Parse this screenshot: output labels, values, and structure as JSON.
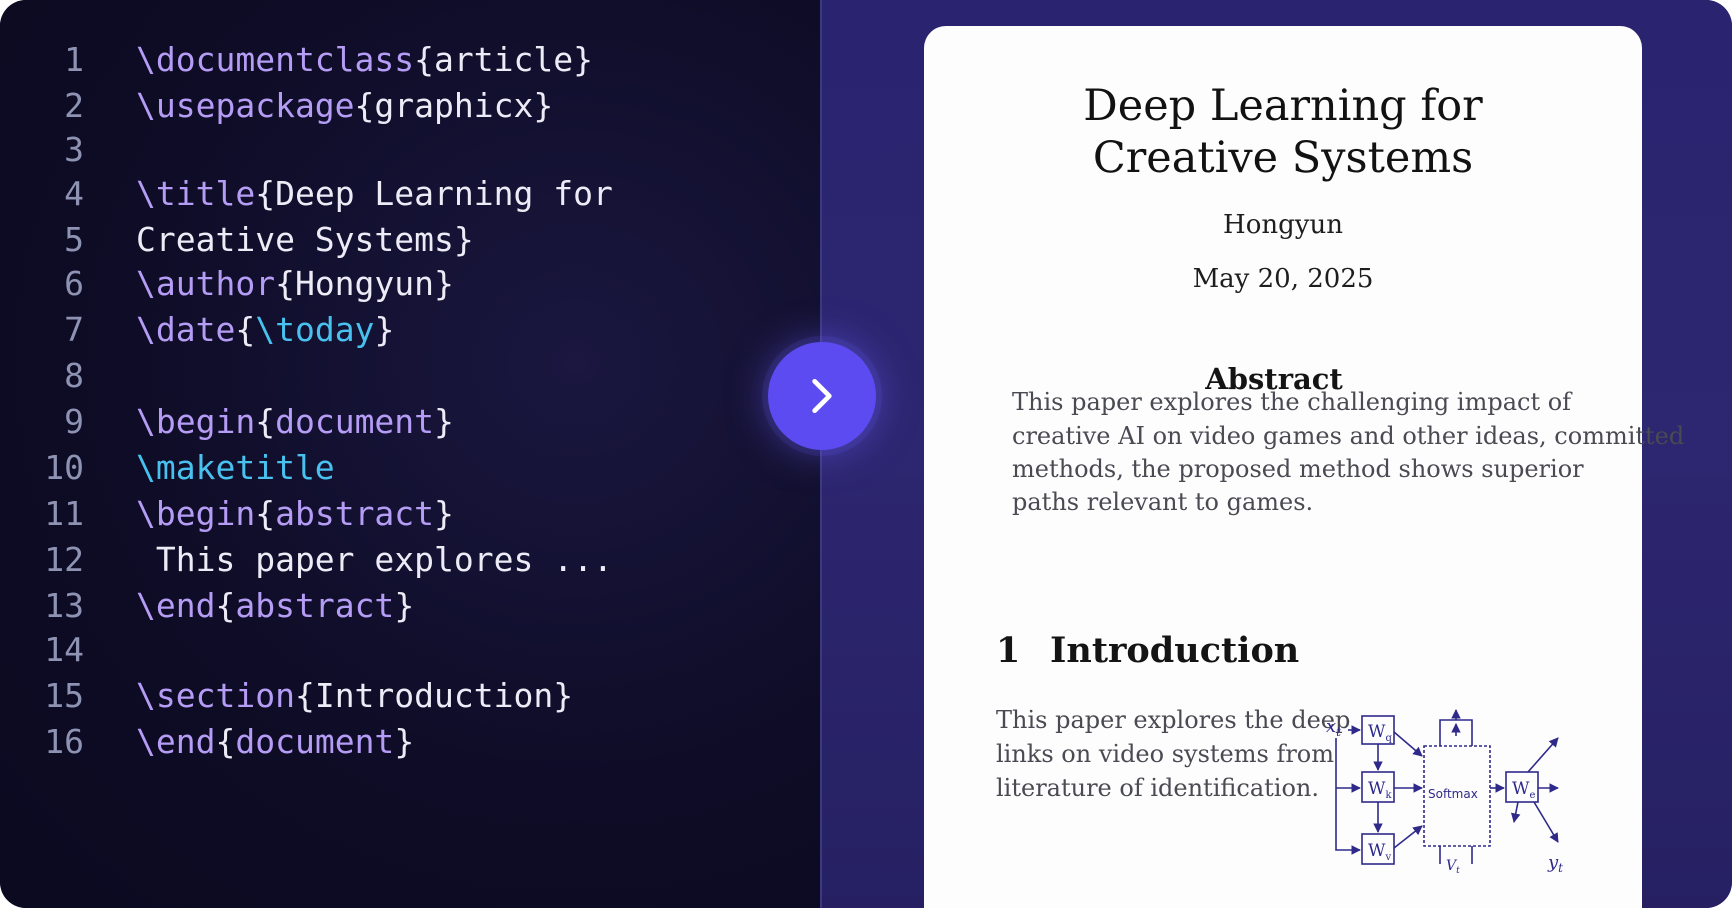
{
  "editor": {
    "lines": [
      {
        "n": "1",
        "parts": [
          [
            "kw",
            "\\documentclass"
          ],
          [
            "txt",
            "{article}"
          ]
        ]
      },
      {
        "n": "2",
        "parts": [
          [
            "kw",
            "\\usepackage"
          ],
          [
            "txt",
            "{graphicx}"
          ]
        ]
      },
      {
        "n": "3",
        "parts": []
      },
      {
        "n": "4",
        "parts": [
          [
            "kw",
            "\\title"
          ],
          [
            "txt",
            "{Deep Learning for"
          ]
        ]
      },
      {
        "n": "5",
        "parts": [
          [
            "txt",
            "Creative Systems}"
          ]
        ]
      },
      {
        "n": "6",
        "parts": [
          [
            "kw",
            "\\author"
          ],
          [
            "txt",
            "{Hongyun}"
          ]
        ]
      },
      {
        "n": "7",
        "parts": [
          [
            "kw",
            "\\date"
          ],
          [
            "txt",
            "{"
          ],
          [
            "cyan",
            "\\today"
          ],
          [
            "txt",
            "}"
          ]
        ]
      },
      {
        "n": "8",
        "parts": []
      },
      {
        "n": "9",
        "parts": [
          [
            "kw",
            "\\begin"
          ],
          [
            "txt",
            "{"
          ],
          [
            "arg",
            "document"
          ],
          [
            "txt",
            "}"
          ]
        ]
      },
      {
        "n": "10",
        "parts": [
          [
            "cyan",
            "\\maketitle"
          ]
        ]
      },
      {
        "n": "11",
        "parts": [
          [
            "kw",
            "\\begin"
          ],
          [
            "txt",
            "{"
          ],
          [
            "arg",
            "abstract"
          ],
          [
            "txt",
            "}"
          ]
        ]
      },
      {
        "n": "12",
        "parts": [
          [
            "txt",
            " This paper explores ..."
          ]
        ]
      },
      {
        "n": "13",
        "parts": [
          [
            "kw",
            "\\end"
          ],
          [
            "txt",
            "{"
          ],
          [
            "arg",
            "abstract"
          ],
          [
            "txt",
            "}"
          ]
        ]
      },
      {
        "n": "14",
        "parts": []
      },
      {
        "n": "15",
        "parts": [
          [
            "kw",
            "\\section"
          ],
          [
            "txt",
            "{Introduction}"
          ]
        ]
      },
      {
        "n": "16",
        "parts": [
          [
            "kw",
            "\\end"
          ],
          [
            "txt",
            "{"
          ],
          [
            "arg",
            "document"
          ],
          [
            "txt",
            "}"
          ]
        ]
      }
    ]
  },
  "compile_button": {
    "icon": "chevron-right-icon"
  },
  "paper": {
    "title_line1": "Deep Learning for",
    "title_line2": "Creative Systems",
    "author": "Hongyun",
    "date": "May 20, 2025",
    "abstract_heading": "Abstract",
    "abstract_lines": [
      "This paper explores the challenging impact of",
      "creative AI on video games and other ideas, committed",
      "methods, the proposed method shows superior",
      "paths relevant to games."
    ],
    "section_number": "1",
    "section_title": "Introduction",
    "body_lines": [
      "This paper explores the deep",
      "links on video systems from",
      "literature of identification."
    ],
    "diagram": {
      "input_label": "x",
      "input_sub": "t",
      "output_label": "y",
      "output_sub": "t",
      "wq": "W",
      "wq_sub": "q",
      "wk": "W",
      "wk_sub": "k",
      "wv": "W",
      "wv_sub": "v",
      "softmax": "Softmax",
      "wo": "W",
      "wo_sub": "e",
      "bottom_label": "V",
      "bottom_sub": "t"
    }
  },
  "colors": {
    "accent": "#5b4bf0",
    "keyword": "#b59cf5",
    "command_cyan": "#49c1ef",
    "diagram_ink": "#2f2a8a"
  }
}
